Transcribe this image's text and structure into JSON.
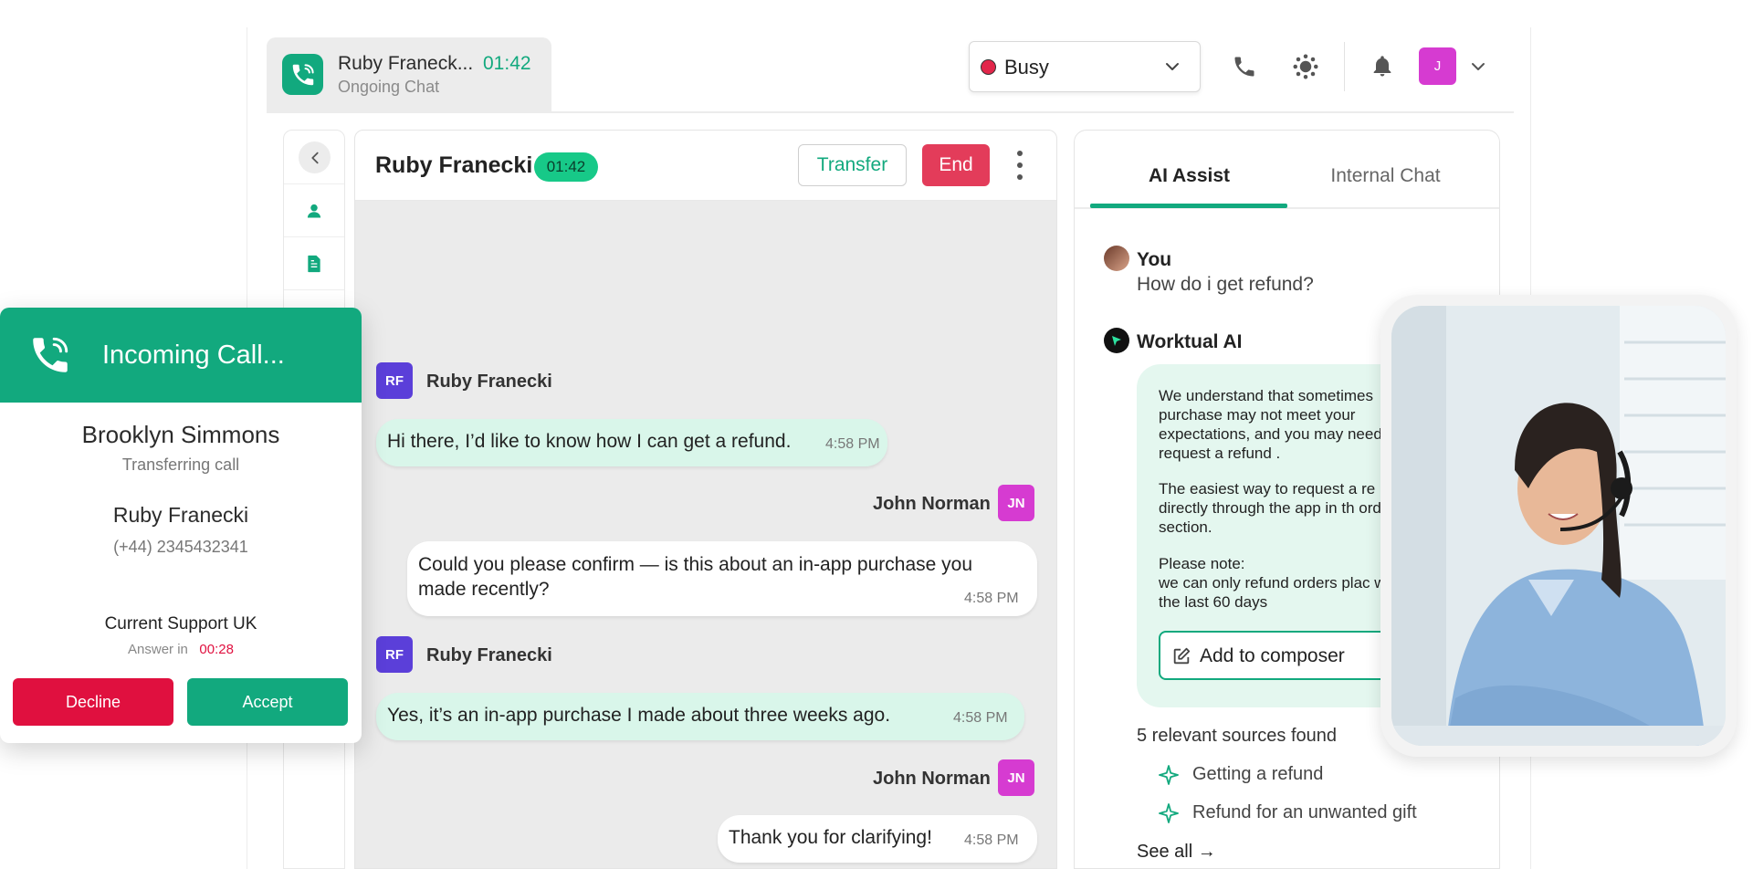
{
  "chat_tab": {
    "name": "Ruby Franeck...",
    "time": "01:42",
    "status": "Ongoing Chat"
  },
  "status_select": {
    "value": "Busy"
  },
  "user_avatar": "J",
  "conversation": {
    "contact_name": "Ruby Franecki",
    "timer": "01:42",
    "transfer_label": "Transfer",
    "end_label": "End",
    "messages": [
      {
        "sender": "Ruby Franecki",
        "initials": "RF",
        "text": "Hi there, I’d like to know how I can get a refund.",
        "time": "4:58 PM"
      },
      {
        "sender": "John Norman",
        "initials": "JN",
        "text": "Could you please confirm — is this about an in-app purchase you made recently?",
        "time": "4:58 PM"
      },
      {
        "sender": "Ruby Franecki",
        "initials": "RF",
        "text": "Yes, it’s an in-app purchase I made about three weeks ago.",
        "time": "4:58 PM"
      },
      {
        "sender": "John Norman",
        "initials": "JN",
        "text": "Thank you for clarifying!",
        "time": "4:58 PM"
      }
    ]
  },
  "ai_panel": {
    "tabs": [
      "AI Assist",
      "Internal Chat"
    ],
    "you_label": "You",
    "you_question": "How do i get refund?",
    "ai_label": "Worktual AI",
    "ai_paragraph_1": "We understand that sometimes purchase may not meet your expectations, and you may need request a refund .",
    "ai_paragraph_2": "The easiest way to request a re is directly through the app in th orders section.",
    "ai_paragraph_3": "Please note:\nwe can only refund orders plac within the last 60 days",
    "add_to_composer": "Add to composer",
    "sources_title": "5 relevant sources found",
    "sources": [
      "Getting a refund",
      "Refund for an unwanted gift"
    ],
    "see_all": "See all →"
  },
  "incoming_call": {
    "title": "Incoming Call...",
    "caller_name": "Brooklyn Simmons",
    "caller_status": "Transferring call",
    "contact_name": "Ruby Franecki",
    "contact_phone": "(+44) 2345432341",
    "queue": "Current Support UK",
    "answer_in_label": "Answer in",
    "answer_in_time": "00:28",
    "decline_label": "Decline",
    "accept_label": "Accept"
  },
  "colors": {
    "accent": "#12a97e",
    "danger": "#e33c5a",
    "decline": "#e0103f",
    "rf_avatar": "#5b3fd9",
    "jn_avatar": "#d63bd1"
  }
}
